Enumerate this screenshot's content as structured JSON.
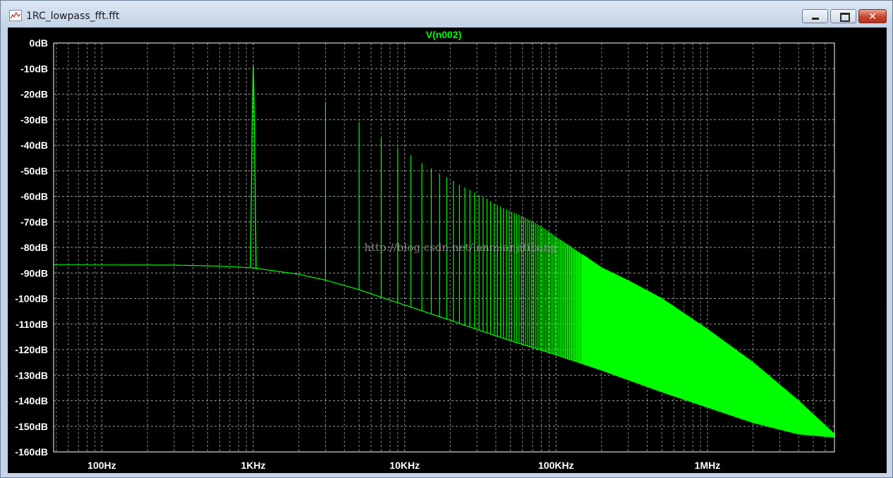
{
  "window": {
    "title": "1RC_lowpass_fft.fft",
    "controls": {
      "minimize": "minimize",
      "maximize": "maximize",
      "close": "close"
    }
  },
  "colors": {
    "background": "#000000",
    "trace": "#00ff00",
    "grid": "#9a9a9a",
    "axis_text": "#ffffff",
    "watermark": "#9a9a9a"
  },
  "watermark": "http://blog.csdn.net/lanmianjitiliang",
  "chart_data": {
    "type": "line",
    "title": "V(n002)",
    "xlabel": "",
    "ylabel": "",
    "x_scale": "log",
    "xlim_hz": [
      48,
      6900000
    ],
    "ylim_db": [
      -160,
      0
    ],
    "grid": true,
    "x_ticks": [
      {
        "value": 100,
        "label": "100Hz"
      },
      {
        "value": 1000,
        "label": "1KHz"
      },
      {
        "value": 10000,
        "label": "10KHz"
      },
      {
        "value": 100000,
        "label": "100KHz"
      },
      {
        "value": 1000000,
        "label": "1MHz"
      }
    ],
    "y_ticks": [
      {
        "value": 0,
        "label": "0dB"
      },
      {
        "value": -10,
        "label": "-10dB"
      },
      {
        "value": -20,
        "label": "-20dB"
      },
      {
        "value": -30,
        "label": "-30dB"
      },
      {
        "value": -40,
        "label": "-40dB"
      },
      {
        "value": -50,
        "label": "-50dB"
      },
      {
        "value": -60,
        "label": "-60dB"
      },
      {
        "value": -70,
        "label": "-70dB"
      },
      {
        "value": -80,
        "label": "-80dB"
      },
      {
        "value": -90,
        "label": "-90dB"
      },
      {
        "value": -100,
        "label": "-100dB"
      },
      {
        "value": -110,
        "label": "-110dB"
      },
      {
        "value": -120,
        "label": "-120dB"
      },
      {
        "value": -130,
        "label": "-130dB"
      },
      {
        "value": -140,
        "label": "-140dB"
      },
      {
        "value": -150,
        "label": "-150dB"
      },
      {
        "value": -160,
        "label": "-160dB"
      }
    ],
    "series": [
      {
        "name": "V(n002)",
        "noise_floor": [
          [
            48,
            -86.8
          ],
          [
            300,
            -86.9
          ],
          [
            600,
            -87.3
          ],
          [
            1000,
            -88.0
          ],
          [
            2000,
            -90.5
          ],
          [
            3000,
            -92.8
          ],
          [
            5000,
            -96.5
          ],
          [
            7000,
            -99.5
          ],
          [
            10000,
            -102.5
          ],
          [
            20000,
            -108.5
          ],
          [
            50000,
            -116.5
          ],
          [
            100000,
            -122.0
          ],
          [
            200000,
            -128.0
          ],
          [
            500000,
            -136.5
          ],
          [
            1000000,
            -142.5
          ],
          [
            2000000,
            -148.5
          ],
          [
            4000000,
            -153.0
          ],
          [
            6900000,
            -154.2
          ]
        ],
        "harmonic_peaks_db": [
          [
            1000,
            -9
          ],
          [
            3000,
            -23
          ],
          [
            5000,
            -31
          ],
          [
            7000,
            -37
          ],
          [
            9000,
            -41
          ],
          [
            11000,
            -44
          ],
          [
            13000,
            -47
          ],
          [
            15000,
            -49
          ],
          [
            17000,
            -51
          ],
          [
            19000,
            -52.5
          ],
          [
            21000,
            -54
          ],
          [
            23000,
            -55.5
          ],
          [
            25000,
            -56.5
          ],
          [
            27000,
            -57.5
          ],
          [
            29000,
            -58.5
          ],
          [
            31000,
            -59.5
          ],
          [
            35000,
            -61
          ],
          [
            41000,
            -63.5
          ],
          [
            51000,
            -66
          ],
          [
            61000,
            -68
          ],
          [
            71000,
            -70
          ],
          [
            81000,
            -72
          ],
          [
            91000,
            -74
          ],
          [
            101000,
            -76
          ],
          [
            121000,
            -79
          ],
          [
            151000,
            -83
          ],
          [
            201000,
            -88
          ],
          [
            301000,
            -93
          ],
          [
            501000,
            -100
          ],
          [
            1001000,
            -112
          ],
          [
            2001000,
            -125
          ],
          [
            4001000,
            -140
          ],
          [
            6900000,
            -153
          ]
        ]
      }
    ]
  }
}
